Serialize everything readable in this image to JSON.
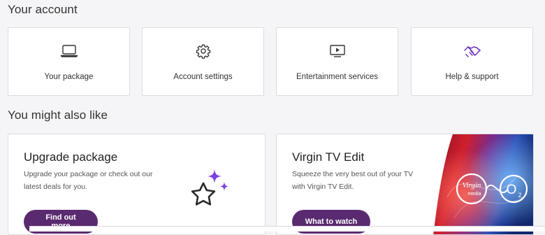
{
  "account": {
    "heading": "Your account",
    "tiles": [
      {
        "label": "Your package",
        "icon": "laptop-icon"
      },
      {
        "label": "Account settings",
        "icon": "gear-icon"
      },
      {
        "label": "Entertainment services",
        "icon": "tv-play-icon"
      },
      {
        "label": "Help & support",
        "icon": "handshake-icon"
      }
    ]
  },
  "suggestions": {
    "heading": "You might also like",
    "cards": [
      {
        "title": "Upgrade package",
        "body": "Upgrade your package or check out our latest deals for you.",
        "button": "Find out more",
        "icon": "star-sparkle-icon"
      },
      {
        "title": "Virgin TV Edit",
        "body": "Squeeze the very best out of your TV with Virgin TV Edit.",
        "button": "What to watch",
        "image": "virgin-media-o2-promo",
        "logo_text": [
          "Virgin",
          "media",
          "O",
          "2"
        ]
      }
    ]
  },
  "colors": {
    "button": "#5a2a70",
    "accent_purple": "#7b3fe4",
    "promo_red": "#d01f2e",
    "promo_blue": "#1b3e9c"
  }
}
